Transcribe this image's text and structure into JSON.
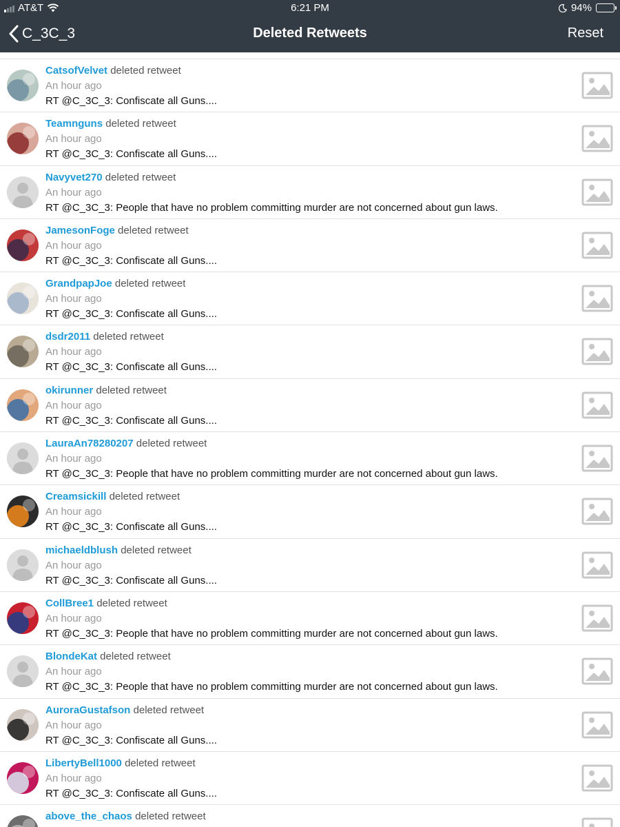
{
  "status_bar": {
    "carrier": "AT&T",
    "time": "6:21 PM",
    "battery": "94%",
    "battery_level": 0.94,
    "signal_bars_active": 1,
    "icons": [
      "signal-icon",
      "wifi-icon",
      "moon-icon",
      "battery-icon"
    ]
  },
  "nav": {
    "back_label": "C_3C_3",
    "title": "Deleted Retweets",
    "reset_label": "Reset"
  },
  "colors": {
    "nav_background": "#333c44",
    "username": "#1f9bd8",
    "timestamp": "#999999",
    "divider": "#e2e2e2"
  },
  "rows": [
    {
      "username": "CatsofVelvet",
      "action": "deleted retweet",
      "time": "An hour ago",
      "text": "RT @C_3C_3: Confiscate all Guns....",
      "avatar": "photo"
    },
    {
      "username": "Teamnguns",
      "action": "deleted retweet",
      "time": "An hour ago",
      "text": "RT @C_3C_3: Confiscate all Guns....",
      "avatar": "photo"
    },
    {
      "username": "Navyvet270",
      "action": "deleted retweet",
      "time": "An hour ago",
      "text": "RT @C_3C_3: People that have no problem committing murder are not concerned about gun laws.",
      "avatar": "default"
    },
    {
      "username": "JamesonFoge",
      "action": "deleted retweet",
      "time": "An hour ago",
      "text": "RT @C_3C_3: Confiscate all Guns....",
      "avatar": "photo"
    },
    {
      "username": "GrandpapJoe",
      "action": "deleted retweet",
      "time": "An hour ago",
      "text": "RT @C_3C_3: Confiscate all Guns....",
      "avatar": "photo"
    },
    {
      "username": "dsdr2011",
      "action": "deleted retweet",
      "time": "An hour ago",
      "text": "RT @C_3C_3: Confiscate all Guns....",
      "avatar": "photo"
    },
    {
      "username": "okirunner",
      "action": "deleted retweet",
      "time": "An hour ago",
      "text": "RT @C_3C_3: Confiscate all Guns....",
      "avatar": "photo"
    },
    {
      "username": "LauraAn78280207",
      "action": "deleted retweet",
      "time": "An hour ago",
      "text": "RT @C_3C_3: People that have no problem committing murder are not concerned about gun laws.",
      "avatar": "default"
    },
    {
      "username": "Creamsickill",
      "action": "deleted retweet",
      "time": "An hour ago",
      "text": "RT @C_3C_3: Confiscate all Guns....",
      "avatar": "photo"
    },
    {
      "username": "michaeldblush",
      "action": "deleted retweet",
      "time": "An hour ago",
      "text": "RT @C_3C_3: Confiscate all Guns....",
      "avatar": "default"
    },
    {
      "username": "CollBree1",
      "action": "deleted retweet",
      "time": "An hour ago",
      "text": "RT @C_3C_3: People that have no problem committing murder are not concerned about gun laws.",
      "avatar": "photo"
    },
    {
      "username": "BlondeKat",
      "action": "deleted retweet",
      "time": "An hour ago",
      "text": "RT @C_3C_3: People that have no problem committing murder are not concerned about gun laws.",
      "avatar": "default"
    },
    {
      "username": "AuroraGustafson",
      "action": "deleted retweet",
      "time": "An hour ago",
      "text": "RT @C_3C_3: Confiscate all Guns....",
      "avatar": "photo"
    },
    {
      "username": "LibertyBell1000",
      "action": "deleted retweet",
      "time": "An hour ago",
      "text": "RT @C_3C_3: Confiscate all Guns....",
      "avatar": "photo"
    },
    {
      "username": "above_the_chaos",
      "action": "deleted retweet",
      "time": "",
      "text": "",
      "avatar": "photo"
    }
  ]
}
